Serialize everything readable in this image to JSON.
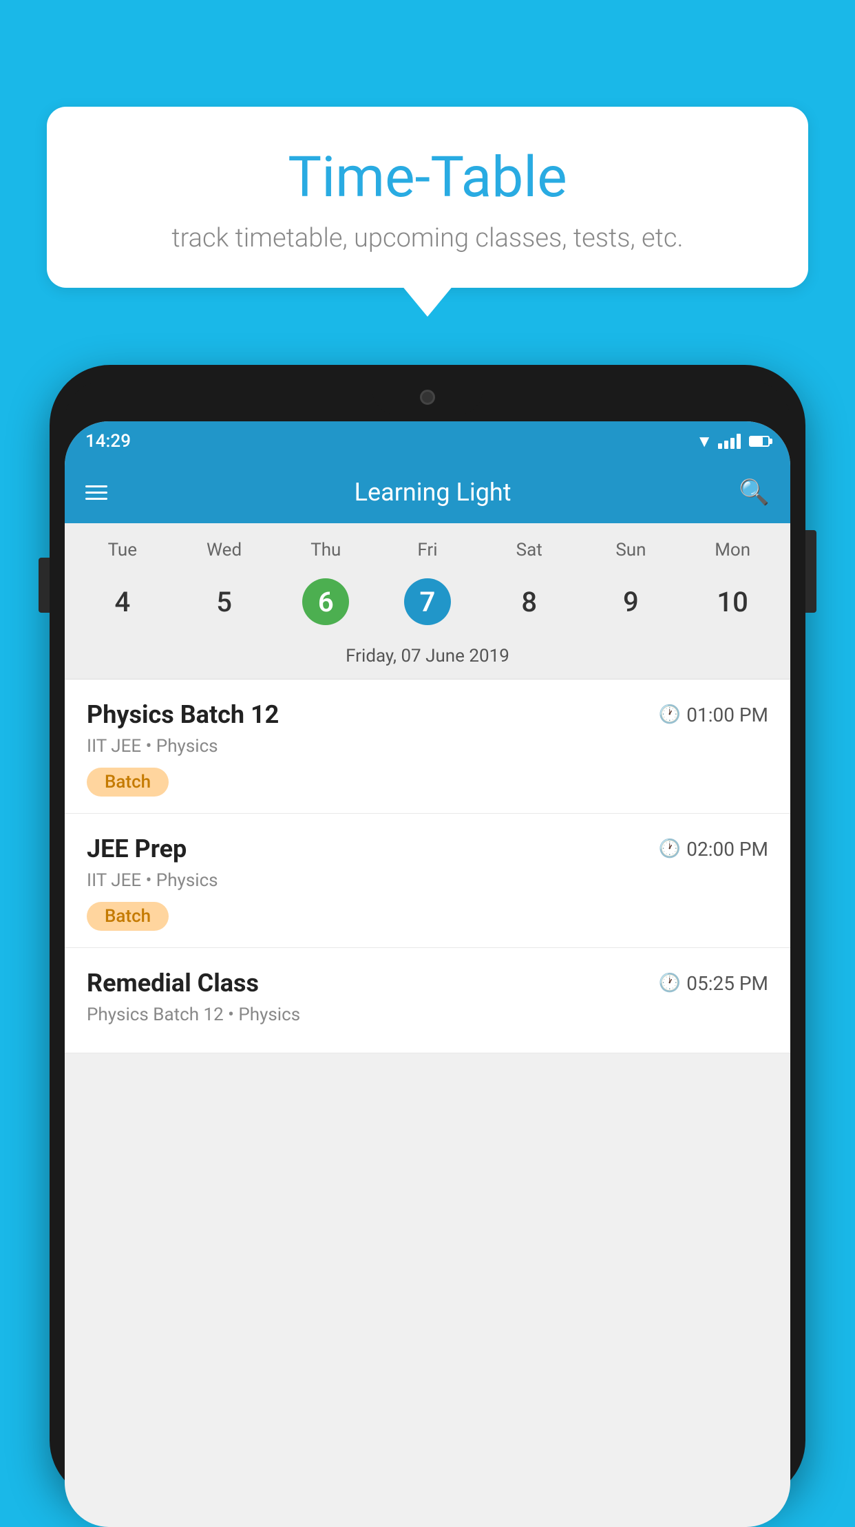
{
  "background_color": "#1ab8e8",
  "speech_bubble": {
    "title": "Time-Table",
    "subtitle": "track timetable, upcoming classes, tests, etc."
  },
  "phone": {
    "status_bar": {
      "time": "14:29"
    },
    "app_header": {
      "title": "Learning Light"
    },
    "calendar": {
      "days": [
        "Tue",
        "Wed",
        "Thu",
        "Fri",
        "Sat",
        "Sun",
        "Mon"
      ],
      "dates": [
        "4",
        "5",
        "6",
        "7",
        "8",
        "9",
        "10"
      ],
      "today_index": 2,
      "selected_index": 3,
      "selected_date_label": "Friday, 07 June 2019"
    },
    "schedule": [
      {
        "title": "Physics Batch 12",
        "time": "01:00 PM",
        "meta": "IIT JEE • Physics",
        "tag": "Batch"
      },
      {
        "title": "JEE Prep",
        "time": "02:00 PM",
        "meta": "IIT JEE • Physics",
        "tag": "Batch"
      },
      {
        "title": "Remedial Class",
        "time": "05:25 PM",
        "meta": "Physics Batch 12 • Physics",
        "tag": ""
      }
    ]
  }
}
